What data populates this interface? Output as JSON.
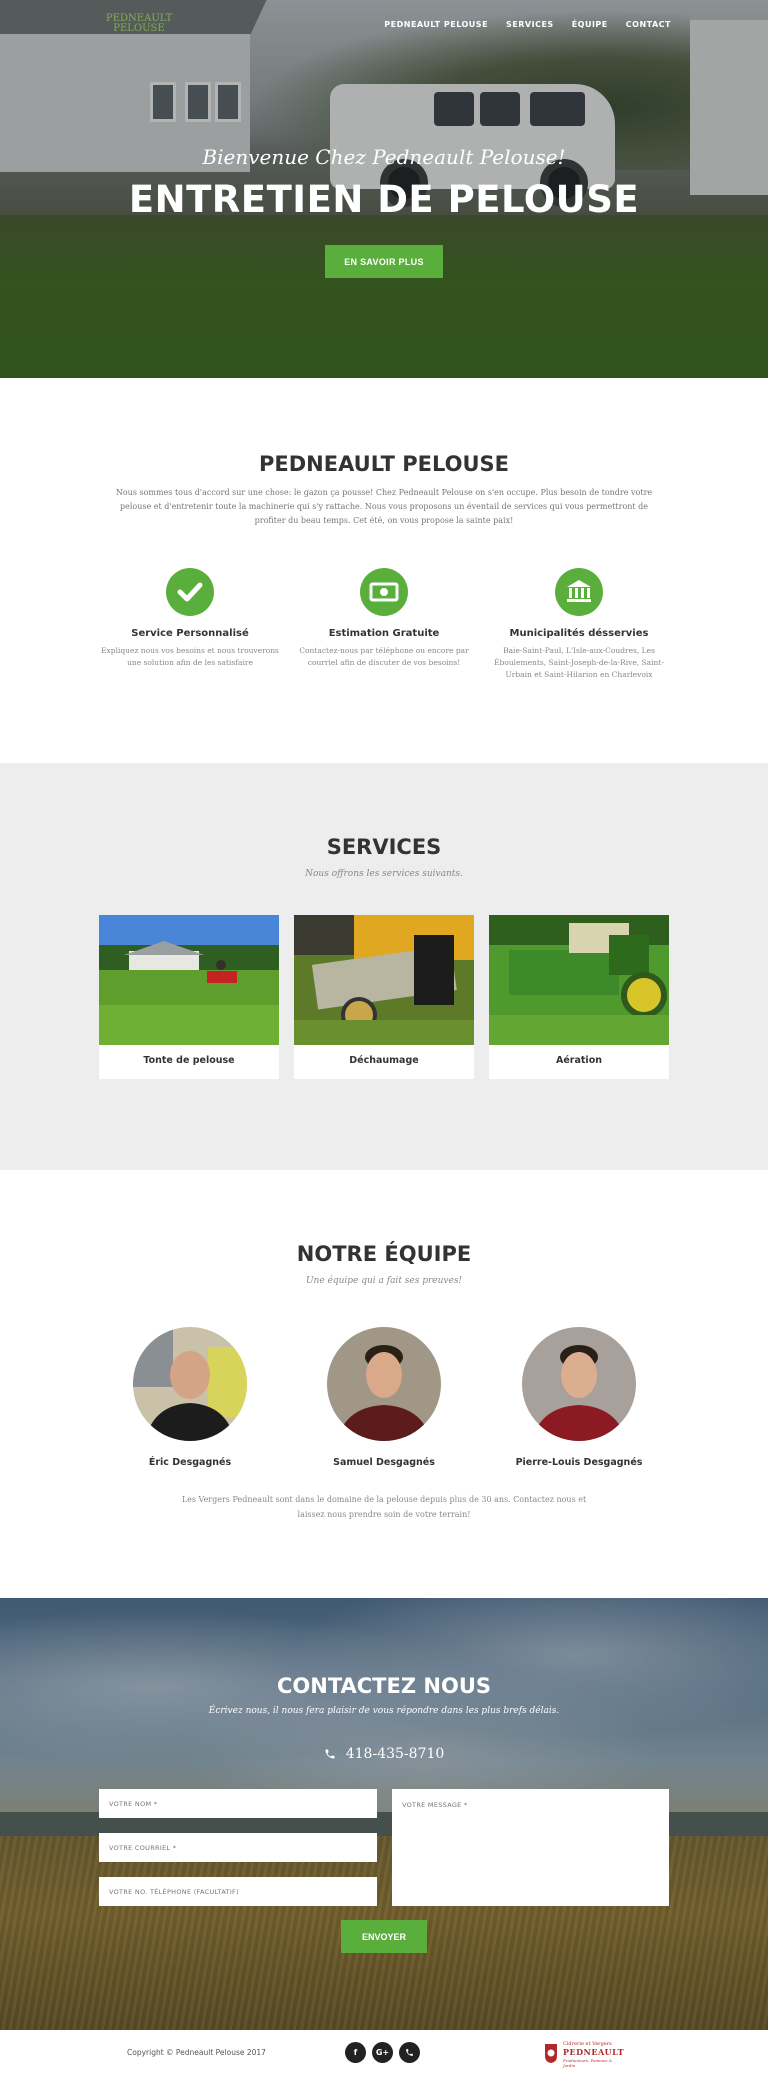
{
  "brand": {
    "logo_line1": "PEDNEAULT",
    "logo_line2": "PELOUSE",
    "green": "#5aaf3c",
    "dark": "#333333"
  },
  "nav": {
    "items": [
      "PEDNEAULT PELOUSE",
      "SERVICES",
      "ÉQUIPE",
      "CONTACT"
    ]
  },
  "hero": {
    "subtitle": "Bienvenue Chez Pedneault Pelouse!",
    "title": "ENTRETIEN DE PELOUSE",
    "button": "EN SAVOIR PLUS"
  },
  "about": {
    "title": "PEDNEAULT PELOUSE",
    "text": "Nous sommes tous d'accord sur une chose: le gazon ça pousse! Chez Pedneault Pelouse on s'en occupe. Plus besoin de tondre votre pelouse et d'entretenir toute la machinerie qui s'y rattache. Nous vous proposons un éventail de services qui vous permettront de profiter du beau temps. Cet été, on vous propose la sainte paix!",
    "features": [
      {
        "icon": "check-icon",
        "title": "Service Personnalisé",
        "text": "Expliquez nous vos besoins et nous trouverons une solution afin de les satisfaire"
      },
      {
        "icon": "money-icon",
        "title": "Estimation Gratuite",
        "text": "Contactez-nous par téléphone ou encore par courriel afin de discuter de vos besoins!"
      },
      {
        "icon": "bank-icon",
        "title": "Municipalités désservies",
        "text": "Baie-Saint-Paul, L'Isle-aux-Coudres, Les Éboulements, Saint-Joseph-de-la-Rive, Saint-Urbain et Saint-Hilarion en Charlevoix"
      }
    ]
  },
  "services": {
    "title": "SERVICES",
    "subtitle": "Nous offrons les services suivants.",
    "cards": [
      {
        "label": "Tonte de pelouse"
      },
      {
        "label": "Déchaumage"
      },
      {
        "label": "Aération"
      }
    ]
  },
  "team": {
    "title": "NOTRE ÉQUIPE",
    "subtitle": "Une équipe qui a fait ses preuves!",
    "members": [
      {
        "name": "Éric Desgagnés"
      },
      {
        "name": "Samuel Desgagnés"
      },
      {
        "name": "Pierre-Louis Desgagnés"
      }
    ],
    "text": "Les Vergers Pedneault sont dans le domaine de la pelouse depuis plus de 30 ans. Contactez nous et laissez nous prendre soin de votre terrain!"
  },
  "contact": {
    "title": "CONTACTEZ NOUS",
    "subtitle": "Écrivez nous, il nous fera plaisir de vous répondre dans les plus brefs délais.",
    "phone": "418-435-8710",
    "name_placeholder": "VOTRE NOM *",
    "email_placeholder": "VOTRE COURRIEL *",
    "tel_placeholder": "VOTRE NO. TÉLÉPHONE (FACULTATIF)",
    "message_placeholder": "VOTRE MESSAGE *",
    "send": "ENVOYER"
  },
  "footer": {
    "copyright": "Copyright © Pedneault Pelouse 2017",
    "social": [
      "f",
      "G+",
      "phone-icon"
    ],
    "partner_line1": "Cidrerie et Vergers",
    "partner_line2": "PEDNEAULT",
    "partner_line3": "Producteurs, Pommes & Jardin"
  }
}
